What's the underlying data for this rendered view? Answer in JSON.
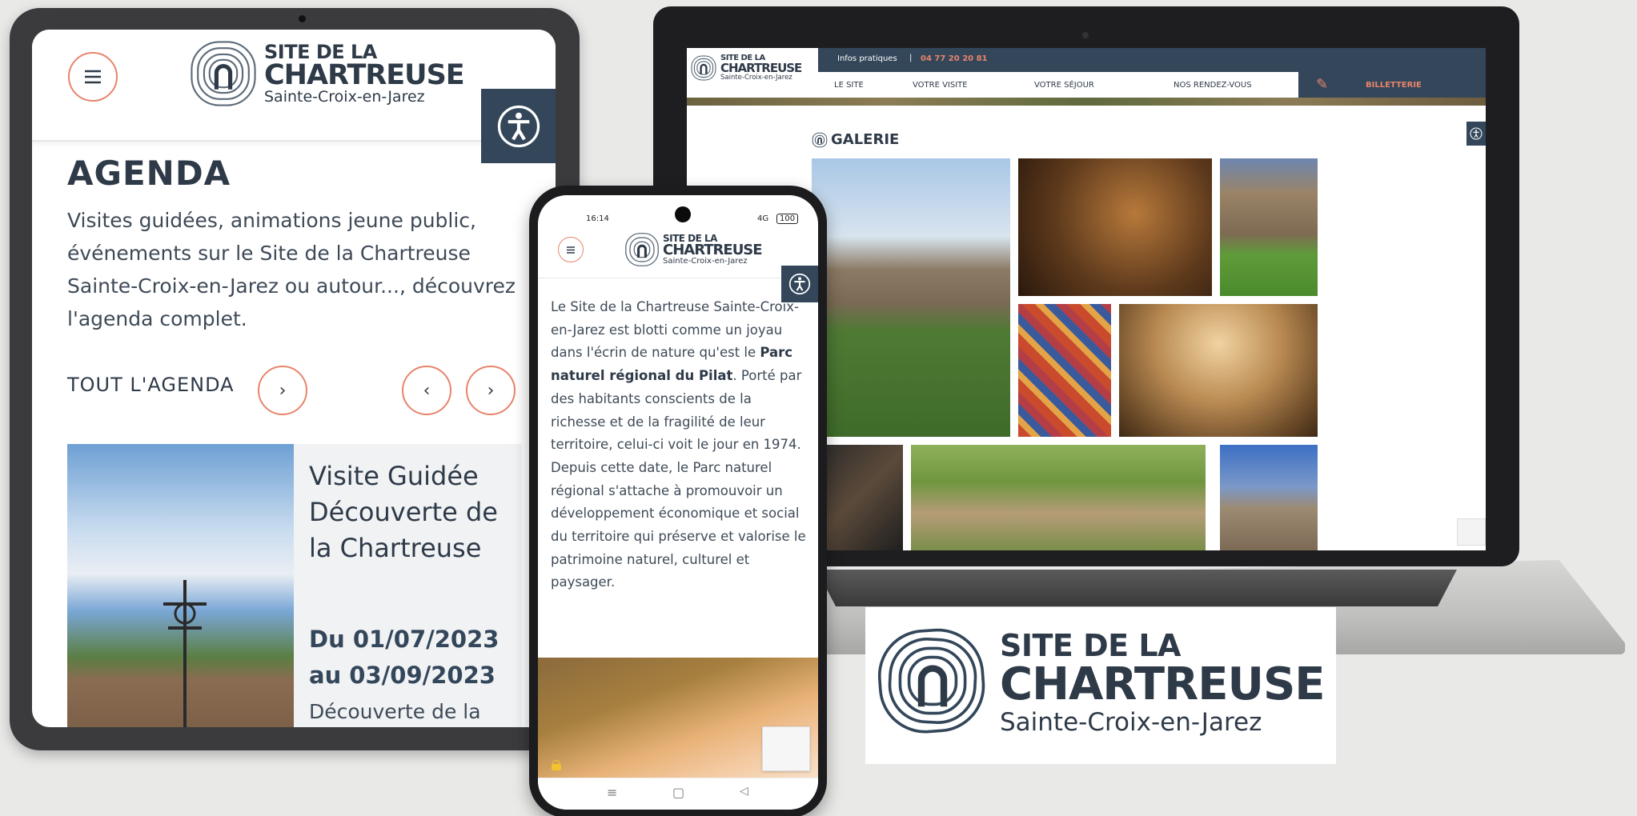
{
  "logo": {
    "line1": "SITE DE LA",
    "line2": "CHARTREUSE",
    "line3": "Sainte-Croix-en-Jarez"
  },
  "colors": {
    "navy": "#33465a",
    "accent": "#e8846b",
    "text": "#2e3a48"
  },
  "tablet": {
    "menu_icon": "hamburger-icon",
    "accessibility_icon": "accessibility-icon",
    "heading": "AGENDA",
    "intro": "Visites guidées, animations jeune public, événements sur le Site de la Chartreuse Sainte-Croix-en-Jarez ou autour..., découvrez l'agenda complet.",
    "all_agenda": "TOUT L'AGENDA",
    "card": {
      "title": "Visite Guidée Découverte de la Chartreuse",
      "dates": "Du 01/07/2023 au 03/09/2023",
      "desc": "Découverte de la"
    }
  },
  "phone": {
    "status_time": "16:14",
    "status_right": "4G",
    "battery": "100",
    "text_before": "Le Site de la Chartreuse Sainte-Croix-en-Jarez est blotti comme un joyau dans l'écrin de nature qu'est le ",
    "text_bold": "Parc naturel régional du Pilat",
    "text_after": ". Porté par des habitants conscients de la richesse et de la fragilité de leur territoire, celui-ci voit le jour en 1974. Depuis cette date, le Parc naturel régional s'attache à promouvoir un développement économique et social du territoire qui préserve et valorise le patrimoine naturel, culturel et paysager."
  },
  "laptop": {
    "infos_label": "Infos pratiques",
    "phone_number": "04 77 20 20 81",
    "nav": [
      "LE SITE",
      "VOTRE VISITE",
      "VOTRE SÉJOUR",
      "NOS RENDEZ-VOUS"
    ],
    "ticket": "BILLETTERIE",
    "gallery_title": "GALERIE"
  }
}
